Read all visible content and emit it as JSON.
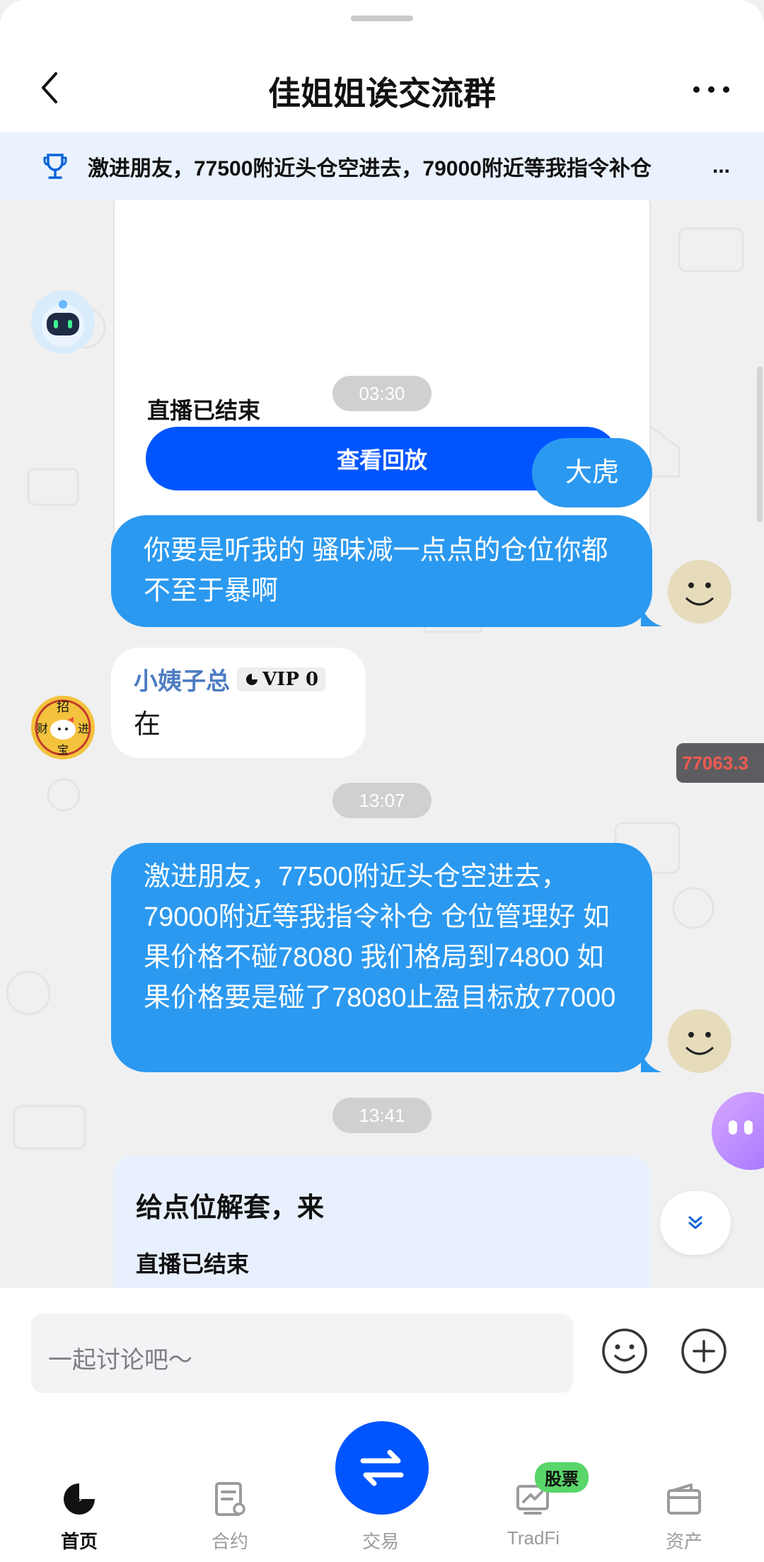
{
  "header": {
    "title": "佳姐姐诶交流群"
  },
  "pinned": {
    "text": "激进朋友，77500附近头仓空进去，79000附近等我指令补仓",
    "ellipsis": "..."
  },
  "messages": {
    "live_card_1": {
      "status": "直播已结束",
      "replay_button": "查看回放"
    },
    "time_1": "03:30",
    "out_1": "大虎",
    "out_2": "你要是听我的   骚味减一点点的仓位你都不至于暴啊",
    "in_1": {
      "sender": "小姨子总",
      "vip": "VIP 0",
      "text": "在"
    },
    "price_tag": "77063.3",
    "time_2": "13:07",
    "out_3": "激进朋友，77500附近头仓空进去，79000附近等我指令补仓      仓位管理好    如果价格不碰78080    我们格局到74800     如果价格要是碰了78080止盈目标放77000",
    "time_3": "13:41",
    "live_card_2": {
      "title": "给点位解套，来",
      "status": "直播已结束"
    }
  },
  "input": {
    "placeholder": "一起讨论吧～"
  },
  "tabbar": {
    "items": [
      "首页",
      "合约",
      "交易",
      "TradFi",
      "资产"
    ],
    "badge": "股票"
  },
  "colors": {
    "accent": "#0055ff",
    "bubble": "#2b99f0",
    "pinned_bg": "#eaf2fd"
  },
  "icons": [
    "back-icon",
    "more-icon",
    "trophy-icon",
    "emoji-icon",
    "plus-icon",
    "home-icon",
    "contract-icon",
    "swap-icon",
    "tradfi-icon",
    "wallet-icon",
    "chevron-down-icon"
  ]
}
